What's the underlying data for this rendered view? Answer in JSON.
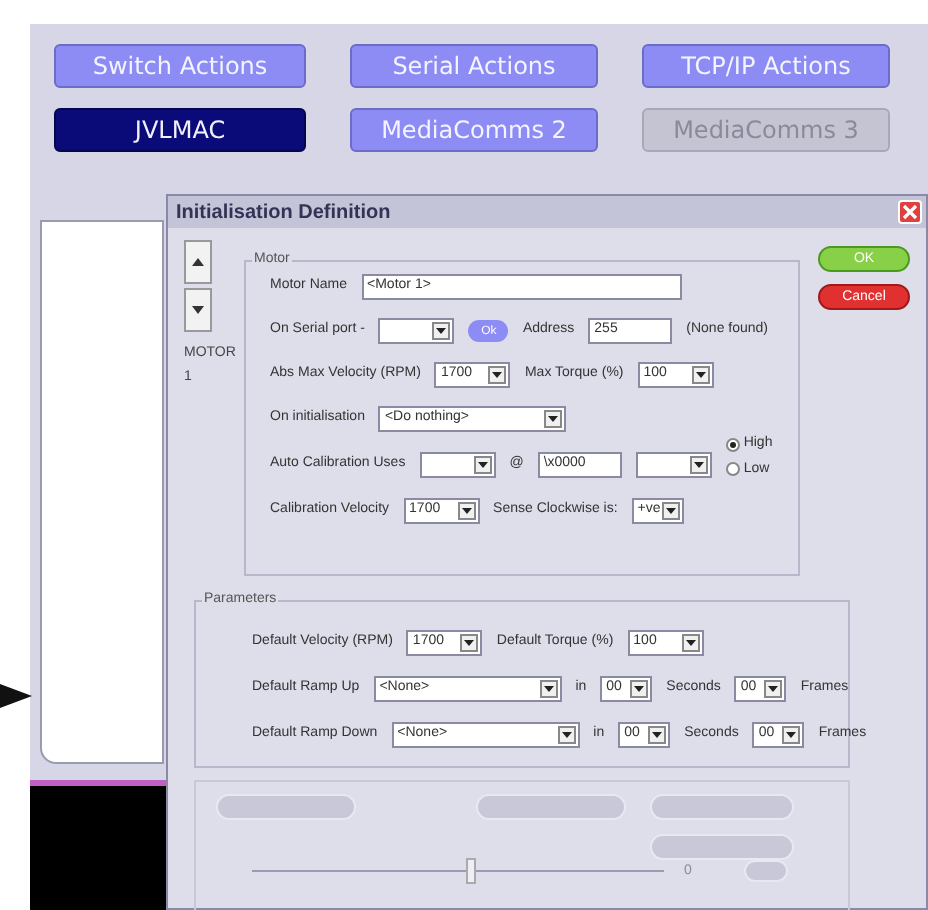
{
  "top_buttons": [
    {
      "label": "Switch Actions",
      "selected": false,
      "disabled": false
    },
    {
      "label": "Serial Actions",
      "selected": false,
      "disabled": false
    },
    {
      "label": "TCP/IP Actions",
      "selected": false,
      "disabled": false
    },
    {
      "label": "JVLMAC",
      "selected": true,
      "disabled": false
    },
    {
      "label": "MediaComms 2",
      "selected": false,
      "disabled": false
    },
    {
      "label": "MediaComms 3",
      "selected": false,
      "disabled": true
    }
  ],
  "dialog": {
    "title": "Initialisation Definition",
    "motor_label": "MOTOR 1",
    "buttons": [
      {
        "label": "OK",
        "kind": "ok"
      },
      {
        "label": "Cancel",
        "kind": "cancel"
      }
    ],
    "motor_group": {
      "title": "Motor",
      "rows": [
        [
          {
            "kind": "label",
            "text": "Motor Name"
          },
          {
            "kind": "field",
            "value": "<Motor 1>"
          }
        ],
        [
          {
            "kind": "label",
            "text": "On Serial port -"
          },
          {
            "kind": "select"
          },
          {
            "kind": "button",
            "text": "Ok"
          },
          {
            "kind": "label",
            "text": "Address"
          },
          {
            "kind": "field",
            "value": "255"
          },
          {
            "kind": "label",
            "text": "(None found)"
          }
        ],
        [
          {
            "kind": "label",
            "text": "Abs Max Velocity (RPM)"
          },
          {
            "kind": "select",
            "value": "1700"
          },
          {
            "kind": "label",
            "text": "Max Torque (%)"
          },
          {
            "kind": "select",
            "value": "100"
          }
        ],
        [
          {
            "kind": "label",
            "text": "On initialisation"
          },
          {
            "kind": "combo",
            "value": "<Do nothing>"
          }
        ],
        [
          {
            "kind": "label",
            "text": "Auto Calibration Uses"
          },
          {
            "kind": "select"
          },
          {
            "kind": "label",
            "text": "@"
          },
          {
            "kind": "field",
            "value": "\\x0000"
          },
          {
            "kind": "select"
          },
          {
            "kind": "radios",
            "options": [
              {
                "label": "High",
                "selected": true
              },
              {
                "label": "Low",
                "selected": false
              }
            ]
          }
        ],
        [
          {
            "kind": "label",
            "text": "Calibration Velocity"
          },
          {
            "kind": "select",
            "value": "1700"
          },
          {
            "kind": "label",
            "text": "Sense Clockwise is:"
          },
          {
            "kind": "small-select",
            "value": "+ve"
          }
        ]
      ]
    },
    "parameters_group": {
      "title": "Parameters",
      "rows": [
        [
          {
            "kind": "label",
            "text": "Default Velocity (RPM)"
          },
          {
            "kind": "select",
            "value": "1700"
          },
          {
            "kind": "label",
            "text": "Default Torque (%)"
          },
          {
            "kind": "select",
            "value": "100"
          }
        ],
        [
          {
            "kind": "label",
            "text": "Default Ramp Up"
          },
          {
            "kind": "combo",
            "value": "<None>"
          },
          {
            "kind": "label",
            "text": "in"
          },
          {
            "kind": "small-select",
            "value": "00"
          },
          {
            "kind": "label",
            "text": "Seconds"
          },
          {
            "kind": "small-select",
            "value": "00"
          },
          {
            "kind": "label",
            "text": "Frames"
          }
        ],
        [
          {
            "kind": "label",
            "text": "Default Ramp Down"
          },
          {
            "kind": "combo",
            "value": "<None>"
          },
          {
            "kind": "label",
            "text": "in"
          },
          {
            "kind": "small-select",
            "value": "00"
          },
          {
            "kind": "label",
            "text": "Seconds"
          },
          {
            "kind": "small-select",
            "value": "00"
          },
          {
            "kind": "label",
            "text": "Frames"
          }
        ]
      ]
    },
    "test_group": {
      "slider": {
        "level": 0.53
      },
      "reading": "0"
    }
  }
}
